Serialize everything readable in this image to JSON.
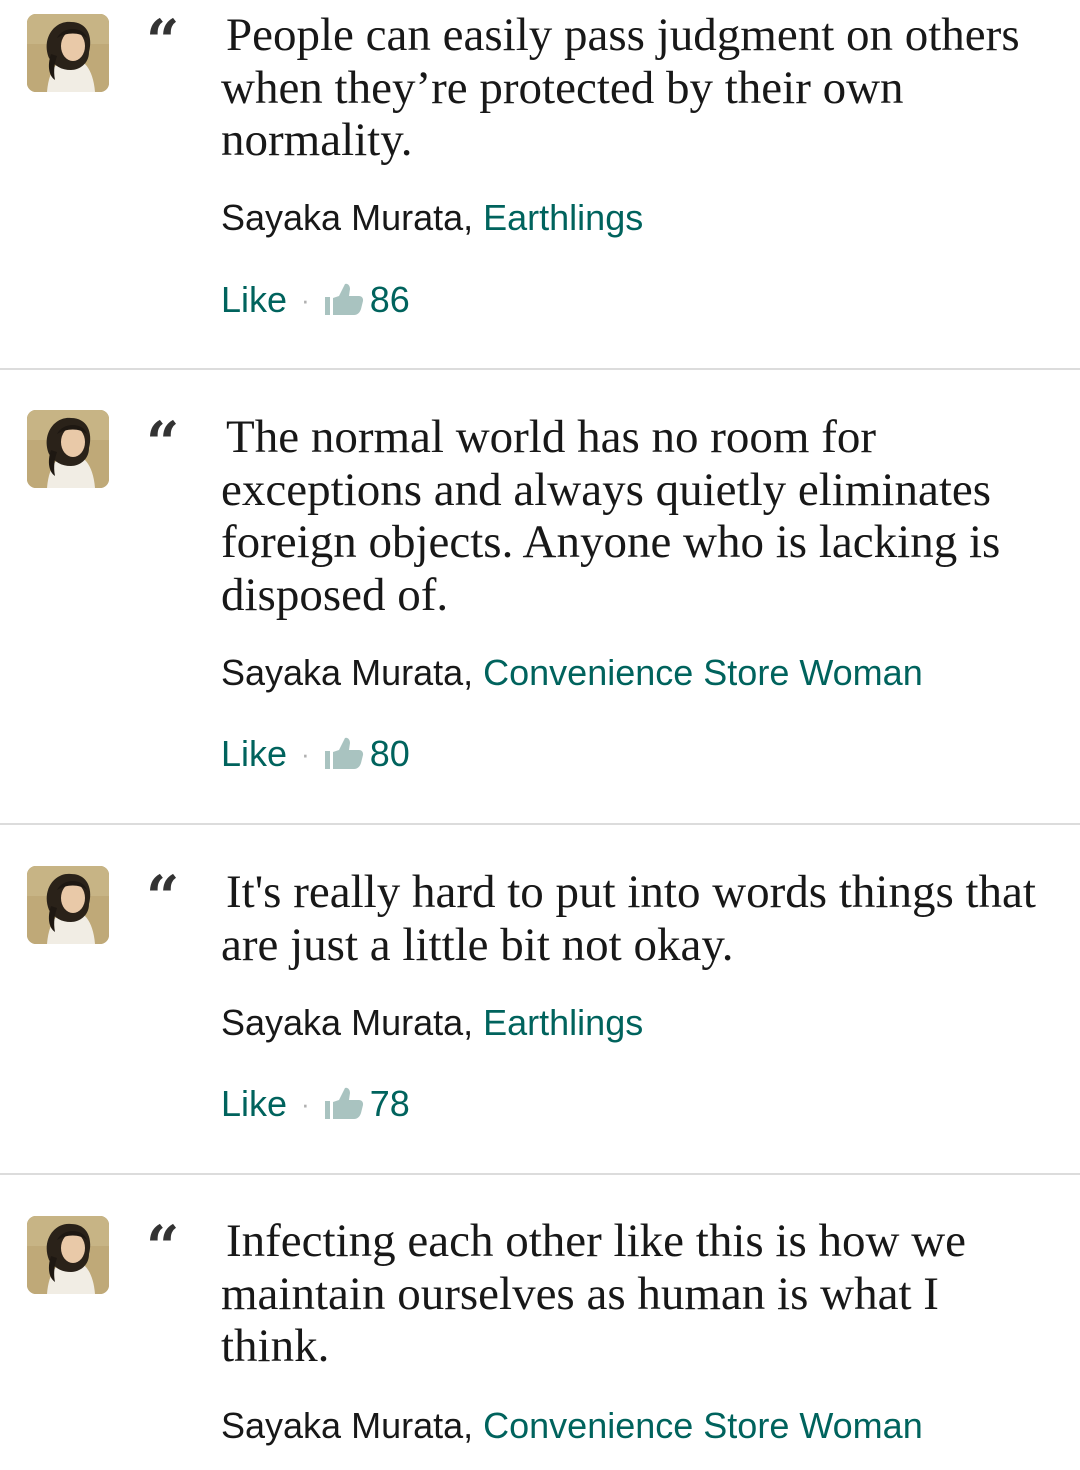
{
  "quote_mark": "“",
  "quotes": [
    {
      "text": "People can easily pass judgment on others when they’re protected by their own normality.",
      "author": "Sayaka Murata,",
      "book": "Earthlings",
      "like_label": "Like",
      "separator": "·",
      "like_count": "86"
    },
    {
      "text": "The normal world has no room for exceptions and always quietly eliminates foreign objects. Anyone who is lacking is disposed of.",
      "author": "Sayaka Murata,",
      "book": "Convenience Store Woman",
      "like_label": "Like",
      "separator": "·",
      "like_count": "80"
    },
    {
      "text": "It's really hard to put into words things that are just a little bit not okay.",
      "author": "Sayaka Murata,",
      "book": "Earthlings",
      "like_label": "Like",
      "separator": "·",
      "like_count": "78"
    },
    {
      "text": "Infecting each other like this is how we maintain ourselves as human is what I think.",
      "author": "Sayaka Murata,",
      "book": "Convenience Store Woman"
    }
  ],
  "colors": {
    "link": "#00635d",
    "text": "#181818",
    "divider": "#dcdcdc",
    "thumb_icon": "#a9c3c0"
  },
  "icons": {
    "avatar": "author-photo",
    "thumb": "thumbs-up-icon"
  }
}
